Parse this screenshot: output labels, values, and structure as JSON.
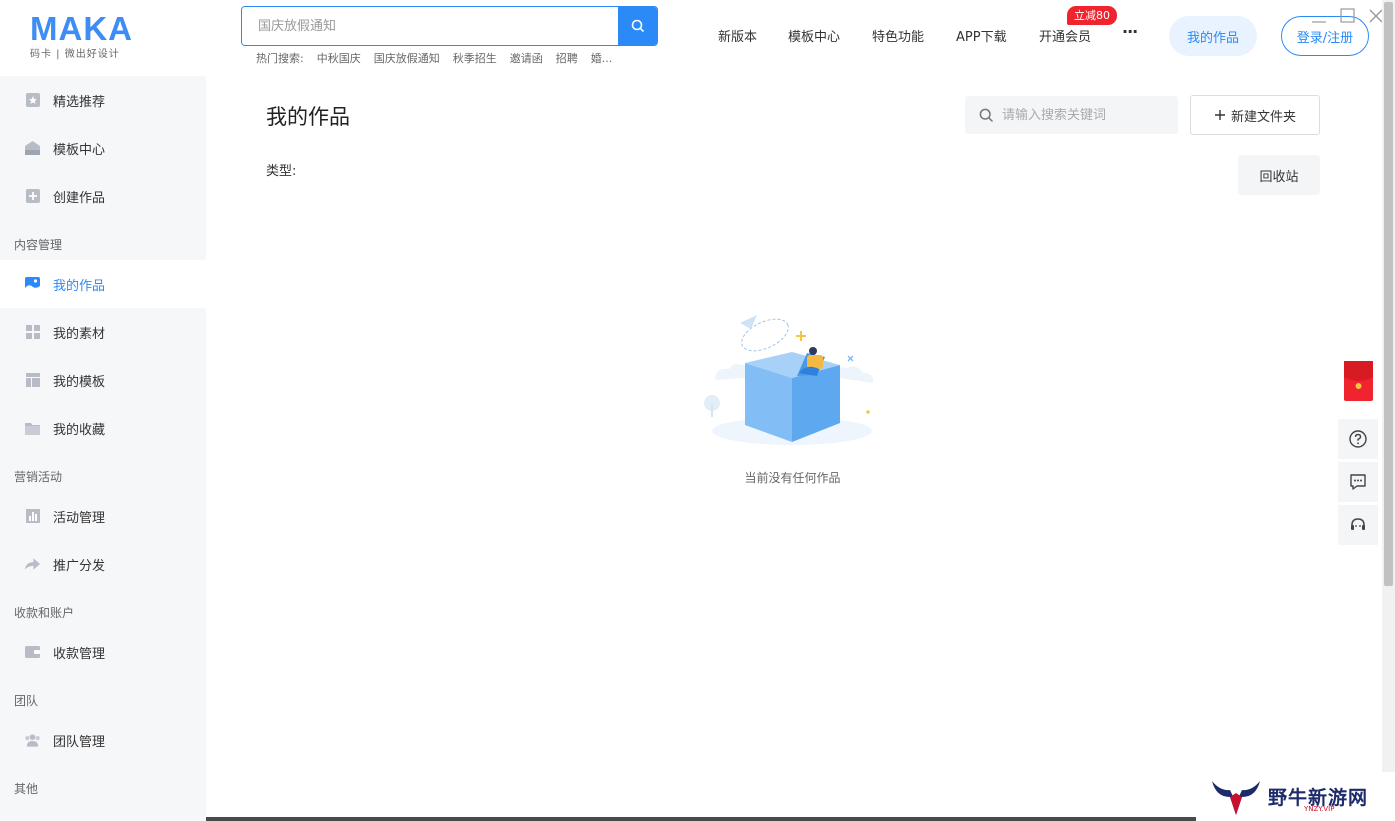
{
  "logo": {
    "brand": "MAKA",
    "sub": "码卡 | 微出好设计"
  },
  "search": {
    "placeholder": "国庆放假通知"
  },
  "hot_search": {
    "label": "热门搜索:",
    "items": [
      "中秋国庆",
      "国庆放假通知",
      "秋季招生",
      "邀请函",
      "招聘",
      "婚..."
    ]
  },
  "nav": {
    "items": [
      "新版本",
      "模板中心",
      "特色功能",
      "APP下载",
      "开通会员"
    ],
    "promo_badge": "立减80",
    "more": "···"
  },
  "header_buttons": {
    "my_works": "我的作品",
    "login": "登录/注册"
  },
  "sidebar": {
    "top_items": [
      "精选推荐",
      "模板中心",
      "创建作品"
    ],
    "sections": [
      {
        "title": "内容管理",
        "items": [
          "我的作品",
          "我的素材",
          "我的模板",
          "我的收藏"
        ]
      },
      {
        "title": "营销活动",
        "items": [
          "活动管理",
          "推广分发"
        ]
      },
      {
        "title": "收款和账户",
        "items": [
          "收款管理"
        ]
      },
      {
        "title": "团队",
        "items": [
          "团队管理"
        ]
      },
      {
        "title": "其他",
        "items": []
      }
    ],
    "active": "我的作品"
  },
  "main": {
    "title": "我的作品",
    "search_placeholder": "请输入搜索关键词",
    "new_folder": "新建文件夹",
    "type_label": "类型:",
    "recycle_bin": "回收站",
    "empty_text": "当前没有任何作品"
  },
  "watermark": {
    "text": "野牛新游网",
    "sub": "YNZY.VIP"
  },
  "colors": {
    "accent": "#2b8af7",
    "promo": "#f0242e",
    "sidebar_bg": "#f6f7f9"
  }
}
